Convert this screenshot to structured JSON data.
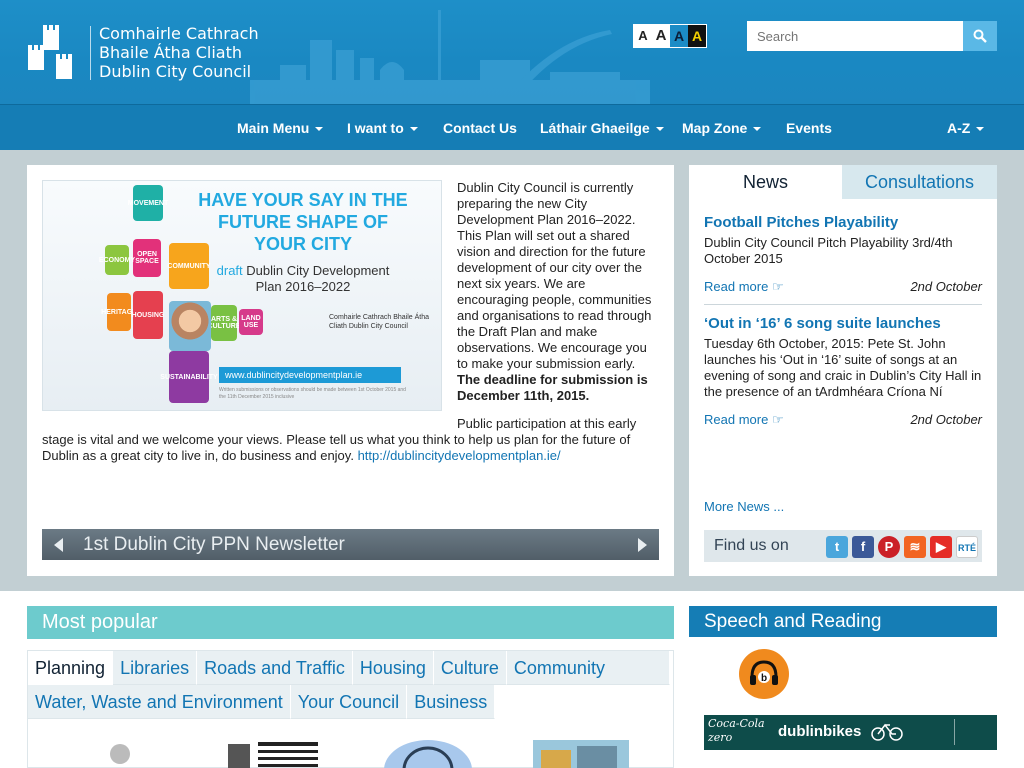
{
  "header": {
    "logo_lines": [
      "Comhairle Cathrach",
      "Bhaile Átha Cliath",
      "Dublin City Council"
    ],
    "font_size_buttons": [
      "A",
      "A",
      "A",
      "A"
    ],
    "search": {
      "placeholder": "Search"
    }
  },
  "nav": {
    "items": [
      {
        "label": "Main Menu",
        "dropdown": true
      },
      {
        "label": "I want to",
        "dropdown": true
      },
      {
        "label": "Contact Us",
        "dropdown": false
      },
      {
        "label": "Láthair Ghaeilge",
        "dropdown": true
      },
      {
        "label": "Map Zone",
        "dropdown": true
      },
      {
        "label": "Events",
        "dropdown": false
      },
      {
        "label": "A-Z",
        "dropdown": true
      }
    ]
  },
  "feature": {
    "promo": {
      "title": "HAVE YOUR SAY IN THE FUTURE SHAPE OF YOUR CITY",
      "draft": "draft",
      "subtitle_rest": "Dublin City Development Plan 2016–2022",
      "url": "www.dublincitydevelopmentplan.ie",
      "fine_print": "Written submissions or observations should be made between 1st October 2015 and the 11th December 2015 inclusive",
      "council": "Comhairle Cathrach Bhaile Átha Cliath Dublin City Council",
      "blocks": [
        "MOVEMENT",
        "OPEN SPACE",
        "ECONOMY",
        "COMMUNITY",
        "HERITAGE",
        "HOUSING",
        "ARTS & CULTURE",
        "LAND USE",
        "SUSTAINABILITY"
      ]
    },
    "text_intro": "Dublin City Council is currently preparing the new City Development Plan 2016–2022. This Plan will set out a shared vision and direction for the future development of our city over the next six years. We are encouraging people, communities and organisations to read through the Draft Plan and make observations. We encourage you to make your submission early.",
    "text_deadline": "The deadline for submission is December 11th, 2015.",
    "para_start": "Public participation at this early",
    "para_rest": "stage is vital and we welcome your views. Please tell us what you think to help us plan for the future of Dublin as a great city to live in, do business and enjoy.",
    "para_link": "http://dublincitydevelopmentplan.ie/",
    "slider_title": "1st Dublin City PPN Newsletter"
  },
  "news": {
    "tabs": [
      "News",
      "Consultations"
    ],
    "items": [
      {
        "title": "Football Pitches Playability",
        "body": "Dublin City Council Pitch Playability 3rd/4th October 2015",
        "more": "Read more",
        "date": "2nd October"
      },
      {
        "title": "‘Out in ‘16’ 6 song suite launches",
        "body": "Tuesday 6th October, 2015: Pete St. John launches his ‘Out in ‘16’ suite of songs at an evening of song and craic in Dublin’s City Hall in the presence of an tArdmhéara Críona Ní",
        "more": "Read more",
        "date": "2nd October"
      }
    ],
    "more_news": "More News ...",
    "find_us": "Find us on",
    "social_icons": [
      "twitter-icon",
      "facebook-icon",
      "pinterest-icon",
      "rss-icon",
      "youtube-icon",
      "rte-icon"
    ],
    "rte_label": "RTÉ"
  },
  "popular": {
    "title": "Most popular",
    "tabs_row1": [
      "Planning",
      "Libraries",
      "Roads and Traffic",
      "Housing",
      "Culture",
      "Community"
    ],
    "tabs_row2": [
      "Water, Waste and Environment",
      "Your Council",
      "Business"
    ]
  },
  "speech": {
    "title": "Speech and Reading",
    "bikes_logo": "Coca-Cola zero",
    "bikes_label": "dublinbikes"
  },
  "colors": {
    "header_blue": "#1e8fc8",
    "nav_blue": "#157db5",
    "link_blue": "#1275b3",
    "teal": "#6dcbcd"
  }
}
